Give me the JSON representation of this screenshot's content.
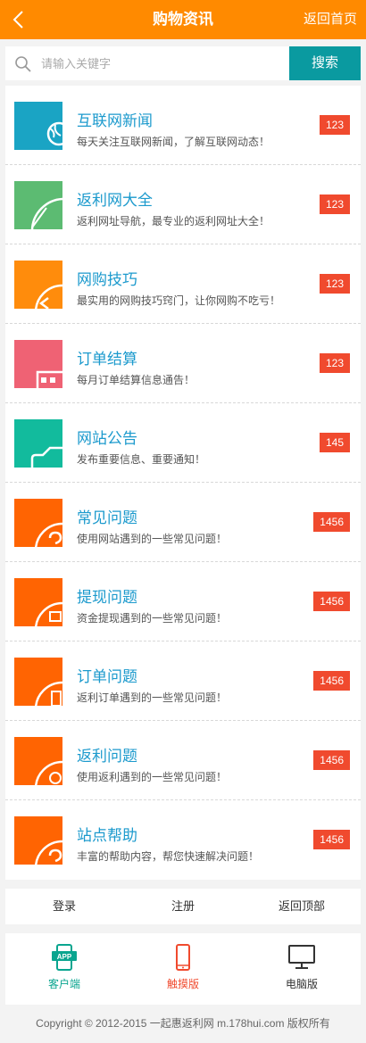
{
  "header": {
    "title": "购物资讯",
    "home_label": "返回首页"
  },
  "search": {
    "placeholder": "请输入关键字",
    "button_label": "搜索"
  },
  "items": [
    {
      "name": "互联网新闻",
      "desc": "每天关注互联网新闻，了解互联网动态！",
      "count": "123",
      "color": "#1aa4c4",
      "icon": "globe-icon"
    },
    {
      "name": "返利网大全",
      "desc": "返利网址导航，最专业的返利网址大全！",
      "count": "123",
      "color": "#5cbb72",
      "icon": "compass-icon"
    },
    {
      "name": "网购技巧",
      "desc": "最实用的网购技巧窍门，让你网购不吃亏！",
      "count": "123",
      "color": "#ff8c0c",
      "icon": "share-icon"
    },
    {
      "name": "订单结算",
      "desc": "每月订单结算信息通告！",
      "count": "123",
      "color": "#ef6274",
      "icon": "calculator-icon"
    },
    {
      "name": "网站公告",
      "desc": "发布重要信息、重要通知！",
      "count": "145",
      "color": "#12bb9d",
      "icon": "notice-icon"
    },
    {
      "name": "常见问题",
      "desc": "使用网站遇到的一些常见问题！",
      "count": "1456",
      "color": "#ff6402",
      "icon": "question-icon"
    },
    {
      "name": "提现问题",
      "desc": "资金提现遇到的一些常见问题！",
      "count": "1456",
      "color": "#ff6402",
      "icon": "withdraw-icon"
    },
    {
      "name": "订单问题",
      "desc": "返利订单遇到的一些常见问题！",
      "count": "1456",
      "color": "#ff6402",
      "icon": "order-icon"
    },
    {
      "name": "返利问题",
      "desc": "使用返利遇到的一些常见问题！",
      "count": "1456",
      "color": "#ff6402",
      "icon": "rebate-icon"
    },
    {
      "name": "站点帮助",
      "desc": "丰富的帮助内容，帮您快速解决问题！",
      "count": "1456",
      "color": "#ff6402",
      "icon": "help-icon"
    }
  ],
  "links": {
    "login": "登录",
    "register": "注册",
    "top": "返回顶部"
  },
  "platforms": {
    "client": {
      "label": "客户端",
      "icon_text": "APP",
      "color": "#0aa58f"
    },
    "touch": {
      "label": "触摸版",
      "color": "#f04a2e"
    },
    "pc": {
      "label": "电脑版",
      "color": "#333333"
    }
  },
  "copyright": "Copyright © 2012-2015 一起惠返利网 m.178hui.com 版权所有",
  "colors": {
    "header": "#ff8a00",
    "search_button": "#0a9aa0",
    "badge": "#f04a2e",
    "link_text": "#1c9acd"
  }
}
